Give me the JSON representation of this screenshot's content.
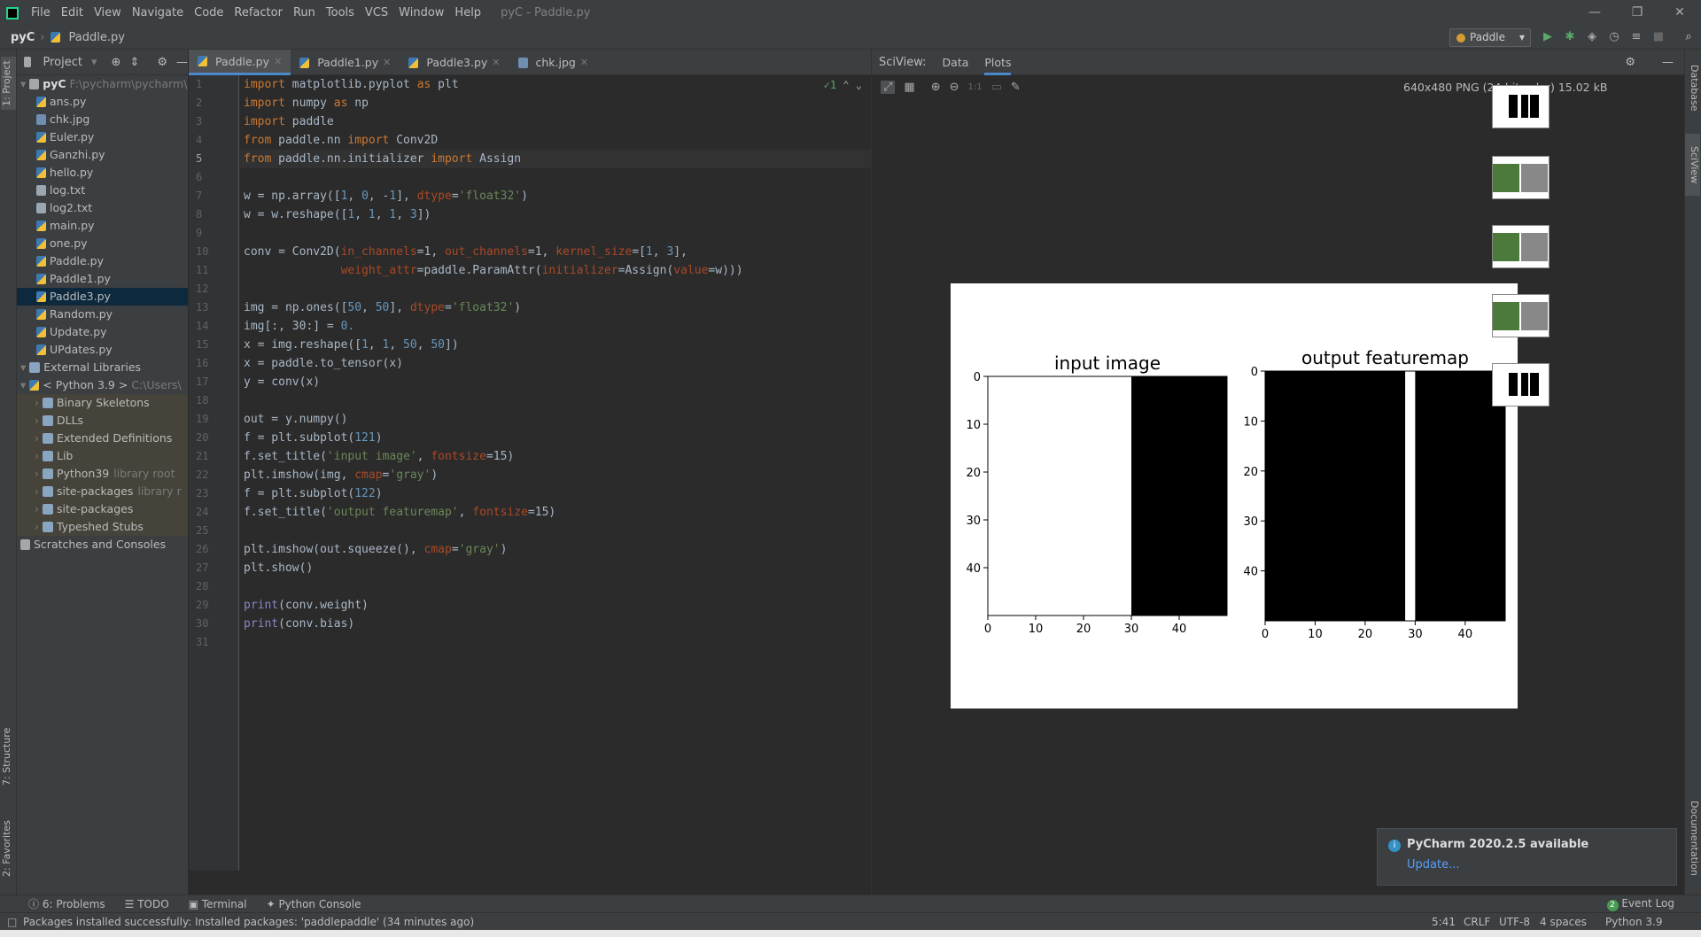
{
  "window": {
    "title": "pyC - Paddle.py",
    "menu": [
      "File",
      "Edit",
      "View",
      "Navigate",
      "Code",
      "Refactor",
      "Run",
      "Tools",
      "VCS",
      "Window",
      "Help"
    ]
  },
  "navbar": {
    "project": "pyC",
    "file": "Paddle.py",
    "run_config": "Paddle"
  },
  "project_panel": {
    "title": "Project",
    "root": {
      "name": "pyC",
      "path": "F:\\pycharm\\pycharm\\py"
    },
    "files": [
      "ans.py",
      "chk.jpg",
      "Euler.py",
      "Ganzhi.py",
      "hello.py",
      "log.txt",
      "log2.txt",
      "main.py",
      "one.py",
      "Paddle.py",
      "Paddle1.py",
      "Paddle3.py",
      "Random.py",
      "Update.py",
      "UPdates.py"
    ],
    "selected": "Paddle3.py",
    "external_libraries": "External Libraries",
    "python_sdk": {
      "name": "< Python 3.9 >",
      "path": "C:\\Users\\"
    },
    "libs": [
      {
        "name": "Binary Skeletons",
        "note": ""
      },
      {
        "name": "DLLs",
        "note": ""
      },
      {
        "name": "Extended Definitions",
        "note": ""
      },
      {
        "name": "Lib",
        "note": ""
      },
      {
        "name": "Python39",
        "note": "library root"
      },
      {
        "name": "site-packages",
        "note": "library r"
      },
      {
        "name": "site-packages",
        "note": ""
      },
      {
        "name": "Typeshed Stubs",
        "note": ""
      }
    ],
    "scratches": "Scratches and Consoles"
  },
  "left_strip": {
    "project": "1: Project",
    "structure": "7: Structure",
    "favorites": "2: Favorites"
  },
  "right_strip": {
    "database": "Database",
    "sciview": "SciView",
    "documentation": "Documentation"
  },
  "editor": {
    "tabs": [
      "Paddle.py",
      "Paddle1.py",
      "Paddle3.py",
      "chk.jpg"
    ],
    "active_tab": "Paddle.py",
    "inspection_count": "1",
    "current_line": 5,
    "line_numbers": [
      "1",
      "2",
      "3",
      "4",
      "5",
      "6",
      "7",
      "8",
      "9",
      "10",
      "11",
      "12",
      "13",
      "14",
      "15",
      "16",
      "17",
      "18",
      "19",
      "20",
      "21",
      "22",
      "23",
      "24",
      "25",
      "26",
      "27",
      "28",
      "29",
      "30",
      "31"
    ],
    "lines": [
      "import matplotlib.pyplot as plt",
      "import numpy as np",
      "import paddle",
      "from paddle.nn import Conv2D",
      "from paddle.nn.initializer import Assign",
      "",
      "w = np.array([1, 0, -1], dtype='float32')",
      "w = w.reshape([1, 1, 1, 3])",
      "",
      "conv = Conv2D(in_channels=1, out_channels=1, kernel_size=[1, 3],",
      "              weight_attr=paddle.ParamAttr(initializer=Assign(value=w)))",
      "",
      "img = np.ones([50, 50], dtype='float32')",
      "img[:, 30:] = 0.",
      "x = img.reshape([1, 1, 50, 50])",
      "x = paddle.to_tensor(x)",
      "y = conv(x)",
      "",
      "out = y.numpy()",
      "f = plt.subplot(121)",
      "f.set_title('input image', fontsize=15)",
      "plt.imshow(img, cmap='gray')",
      "f = plt.subplot(122)",
      "f.set_title('output featuremap', fontsize=15)",
      "",
      "plt.imshow(out.squeeze(), cmap='gray')",
      "plt.show()",
      "",
      "print(conv.weight)",
      "print(conv.bias)",
      ""
    ]
  },
  "sciview": {
    "label": "SciView:",
    "tabs": [
      "Data",
      "Plots"
    ],
    "active_tab": "Plots",
    "image_info": "640x480 PNG (24-bit color) 15.02 kB",
    "zoom_actual": "1:1",
    "thumbnails_count": 5
  },
  "chart_data": [
    {
      "type": "heatmap",
      "title": "input image",
      "xticks": [
        "0",
        "10",
        "20",
        "30",
        "40"
      ],
      "yticks": [
        "0",
        "10",
        "20",
        "30",
        "40"
      ],
      "xlim": [
        0,
        50
      ],
      "ylim": [
        0,
        50
      ],
      "colormap": "gray",
      "description_values": {
        "white_columns": [
          0,
          30
        ],
        "black_columns": [
          30,
          50
        ]
      }
    },
    {
      "type": "heatmap",
      "title": "output featuremap",
      "xticks": [
        "0",
        "10",
        "20",
        "30",
        "40"
      ],
      "yticks": [
        "0",
        "10",
        "20",
        "30",
        "40"
      ],
      "xlim": [
        0,
        48
      ],
      "ylim": [
        0,
        50
      ],
      "colormap": "gray",
      "description_values": {
        "white_columns": [
          28,
          30
        ],
        "black_columns_left": [
          0,
          28
        ],
        "black_columns_right": [
          30,
          48
        ]
      }
    }
  ],
  "notification": {
    "title": "PyCharm 2020.2.5 available",
    "link": "Update..."
  },
  "tool_tabs": {
    "problems": "6: Problems",
    "todo": "TODO",
    "terminal": "Terminal",
    "console": "Python Console",
    "event_log": "Event Log",
    "event_count": "2"
  },
  "statusbar": {
    "message": "Packages installed successfully: Installed packages: 'paddlepaddle' (34 minutes ago)",
    "position": "5:41",
    "line_sep": "CRLF",
    "encoding": "UTF-8",
    "indent": "4 spaces",
    "interpreter": "Python 3.9"
  },
  "colors": {
    "accent": "#4a88c7",
    "bg": "#2b2b2b",
    "panel": "#3c3f41",
    "selection": "#0d293e"
  }
}
